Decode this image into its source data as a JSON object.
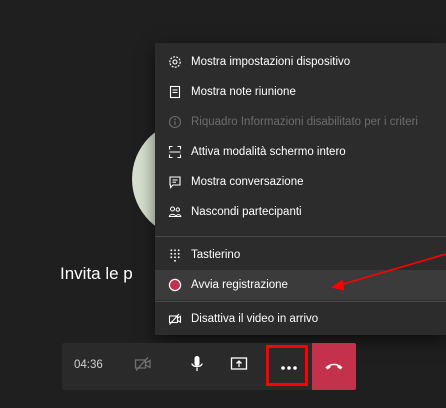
{
  "stage": {
    "invite_text": "Invita le p"
  },
  "menu": {
    "items": [
      {
        "label": "Mostra impostazioni dispositivo",
        "icon": "gear-icon"
      },
      {
        "label": "Mostra note riunione",
        "icon": "notes-icon"
      },
      {
        "label": "Riquadro Informazioni disabilitato per i criteri",
        "icon": "info-icon"
      },
      {
        "label": "Attiva modalità schermo intero",
        "icon": "fullscreen-icon"
      },
      {
        "label": "Mostra conversazione",
        "icon": "chat-icon"
      },
      {
        "label": "Nascondi partecipanti",
        "icon": "people-icon"
      },
      {
        "label": "Tastierino",
        "icon": "keypad-icon"
      },
      {
        "label": "Avvia registrazione",
        "icon": "record-icon"
      },
      {
        "label": "Disattiva il video in arrivo",
        "icon": "video-off-icon"
      }
    ]
  },
  "controls": {
    "timer": "04:36"
  },
  "colors": {
    "hangup": "#c4314b",
    "record": "#c4314b",
    "annotation": "#ff0000"
  }
}
